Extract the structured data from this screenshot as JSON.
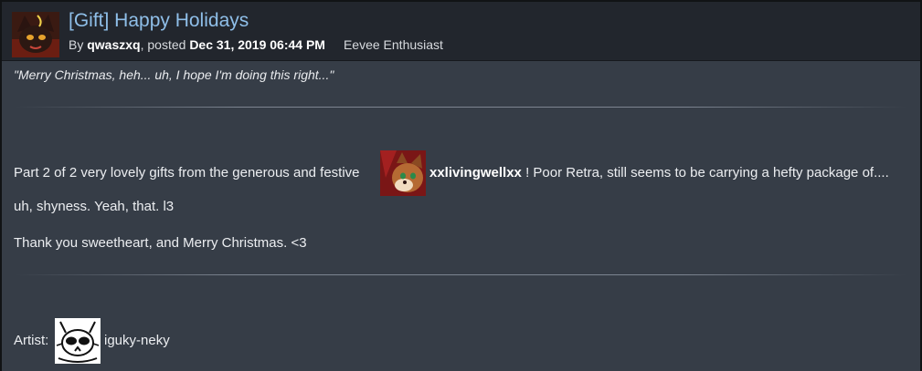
{
  "post": {
    "title": "[Gift] Happy Holidays",
    "by_prefix": "By",
    "author": "qwaszxq",
    "posted_prefix": ", posted",
    "date": "Dec 31, 2019 06:44 PM",
    "author_title": "Eevee Enthusiast",
    "quote": "\"Merry Christmas, heh... uh, I hope I'm doing this right...\""
  },
  "body": {
    "line1_before": "Part 2 of 2 very lovely gifts from the generous and festive",
    "gifter": "xxlivingwellxx",
    "line1_after": "! Poor Retra, still seems to be carrying a hefty package of....",
    "line2": "uh, shyness. Yeah, that. l3",
    "line3": "Thank you sweetheart, and Merry Christmas. <3",
    "artist_label": "Artist:",
    "artist_name": "iguky-neky"
  },
  "colors": {
    "title": "#8fbfe9",
    "header_bg": "#22262d",
    "body_bg": "#363d47"
  }
}
